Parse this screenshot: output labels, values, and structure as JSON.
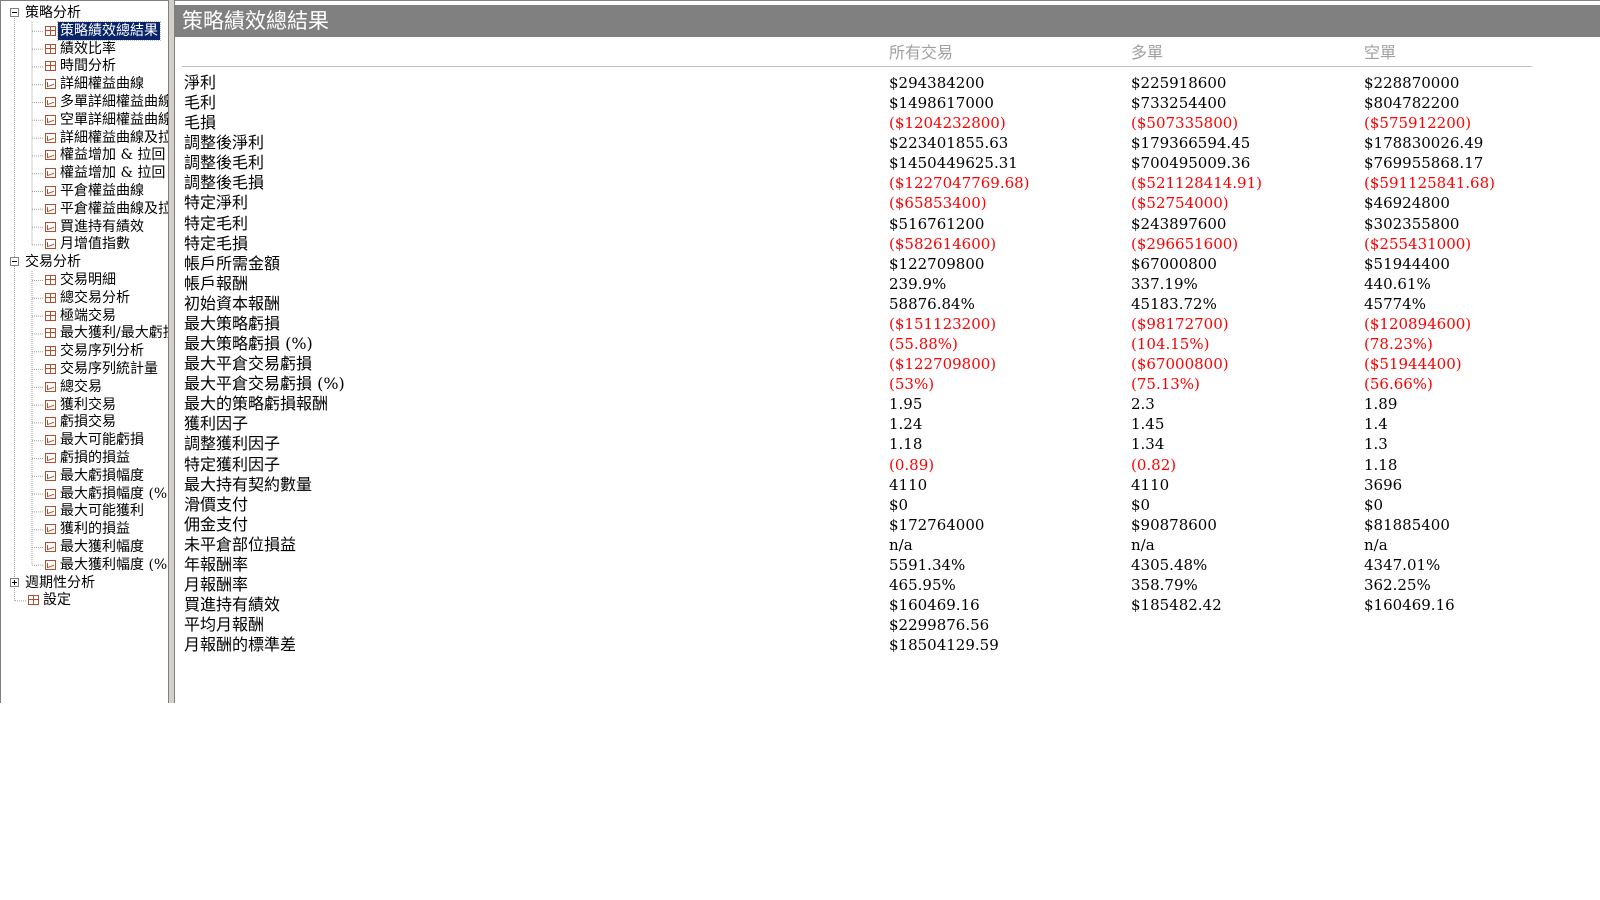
{
  "tree": {
    "nodes": [
      {
        "label": "策略分析",
        "type": "group",
        "expander": "minus",
        "level": 0
      },
      {
        "label": "策略績效總結果",
        "type": "table",
        "level": 1,
        "selected": true
      },
      {
        "label": "績效比率",
        "type": "table",
        "level": 1
      },
      {
        "label": "時間分析",
        "type": "table",
        "level": 1
      },
      {
        "label": "詳細權益曲線",
        "type": "chart",
        "level": 1
      },
      {
        "label": "多單詳細權益曲線",
        "type": "chart",
        "level": 1
      },
      {
        "label": "空單詳細權益曲線",
        "type": "chart",
        "level": 1
      },
      {
        "label": "詳細權益曲線及拉回",
        "type": "chart",
        "level": 1
      },
      {
        "label": "權益增加 & 拉回",
        "type": "chart",
        "level": 1
      },
      {
        "label": "權益增加 & 拉回",
        "type": "chart",
        "level": 1
      },
      {
        "label": "平倉權益曲線",
        "type": "chart",
        "level": 1
      },
      {
        "label": "平倉權益曲線及拉回",
        "type": "chart",
        "level": 1
      },
      {
        "label": "買進持有績效",
        "type": "chart",
        "level": 1
      },
      {
        "label": "月增值指數",
        "type": "chart",
        "level": 1
      },
      {
        "label": "交易分析",
        "type": "group",
        "expander": "minus",
        "level": 0
      },
      {
        "label": "交易明細",
        "type": "table",
        "level": 1
      },
      {
        "label": "總交易分析",
        "type": "table",
        "level": 1
      },
      {
        "label": "極端交易",
        "type": "table",
        "level": 1
      },
      {
        "label": "最大獲利/最大虧損",
        "type": "table",
        "level": 1
      },
      {
        "label": "交易序列分析",
        "type": "table",
        "level": 1
      },
      {
        "label": "交易序列統計量",
        "type": "table",
        "level": 1
      },
      {
        "label": "總交易",
        "type": "chart",
        "level": 1
      },
      {
        "label": "獲利交易",
        "type": "chart",
        "level": 1
      },
      {
        "label": "虧損交易",
        "type": "chart",
        "level": 1
      },
      {
        "label": "最大可能虧損",
        "type": "chart",
        "level": 1
      },
      {
        "label": "虧損的損益",
        "type": "chart",
        "level": 1
      },
      {
        "label": "最大虧損幅度",
        "type": "chart",
        "level": 1
      },
      {
        "label": "最大虧損幅度 (%)",
        "type": "chart",
        "level": 1
      },
      {
        "label": "最大可能獲利",
        "type": "chart",
        "level": 1
      },
      {
        "label": "獲利的損益",
        "type": "chart",
        "level": 1
      },
      {
        "label": "最大獲利幅度",
        "type": "chart",
        "level": 1
      },
      {
        "label": "最大獲利幅度 (%)",
        "type": "chart",
        "level": 1
      },
      {
        "label": "週期性分析",
        "type": "group",
        "expander": "plus",
        "level": 0
      },
      {
        "label": "設定",
        "type": "table",
        "level": 0.5
      }
    ]
  },
  "main": {
    "title": "策略績效總結果",
    "columns": [
      "所有交易",
      "多單",
      "空單"
    ],
    "rows": [
      {
        "label": "淨利",
        "values": [
          "$294384200",
          "$225918600",
          "$228870000"
        ]
      },
      {
        "label": "毛利",
        "values": [
          "$1498617000",
          "$733254400",
          "$804782200"
        ]
      },
      {
        "label": "毛損",
        "values": [
          "($1204232800)",
          "($507335800)",
          "($575912200)"
        ]
      },
      {
        "label": "調整後淨利",
        "values": [
          "$223401855.63",
          "$179366594.45",
          "$178830026.49"
        ]
      },
      {
        "label": "調整後毛利",
        "values": [
          "$1450449625.31",
          "$700495009.36",
          "$769955868.17"
        ]
      },
      {
        "label": "調整後毛損",
        "values": [
          "($1227047769.68)",
          "($521128414.91)",
          "($591125841.68)"
        ]
      },
      {
        "label": "特定淨利",
        "values": [
          "($65853400)",
          "($52754000)",
          "$46924800"
        ]
      },
      {
        "label": "特定毛利",
        "values": [
          "$516761200",
          "$243897600",
          "$302355800"
        ]
      },
      {
        "label": "特定毛損",
        "values": [
          "($582614600)",
          "($296651600)",
          "($255431000)"
        ]
      },
      {
        "label": "帳戶所需金額",
        "values": [
          "$122709800",
          "$67000800",
          "$51944400"
        ]
      },
      {
        "label": "帳戶報酬",
        "values": [
          "239.9%",
          "337.19%",
          "440.61%"
        ]
      },
      {
        "label": "初始資本報酬",
        "values": [
          "58876.84%",
          "45183.72%",
          "45774%"
        ]
      },
      {
        "label": "最大策略虧損",
        "values": [
          "($151123200)",
          "($98172700)",
          "($120894600)"
        ]
      },
      {
        "label": "最大策略虧損 (%)",
        "values": [
          "(55.88%)",
          "(104.15%)",
          "(78.23%)"
        ]
      },
      {
        "label": "最大平倉交易虧損",
        "values": [
          "($122709800)",
          "($67000800)",
          "($51944400)"
        ]
      },
      {
        "label": "最大平倉交易虧損 (%)",
        "values": [
          "(53%)",
          "(75.13%)",
          "(56.66%)"
        ]
      },
      {
        "label": "最大的策略虧損報酬",
        "values": [
          "1.95",
          "2.3",
          "1.89"
        ]
      },
      {
        "label": "獲利因子",
        "values": [
          "1.24",
          "1.45",
          "1.4"
        ]
      },
      {
        "label": "調整獲利因子",
        "values": [
          "1.18",
          "1.34",
          "1.3"
        ]
      },
      {
        "label": "特定獲利因子",
        "values": [
          "(0.89)",
          "(0.82)",
          "1.18"
        ]
      },
      {
        "label": "最大持有契約數量",
        "values": [
          "4110",
          "4110",
          "3696"
        ]
      },
      {
        "label": "滑價支付",
        "values": [
          "$0",
          "$0",
          "$0"
        ]
      },
      {
        "label": "佣金支付",
        "values": [
          "$172764000",
          "$90878600",
          "$81885400"
        ]
      },
      {
        "label": "未平倉部位損益",
        "values": [
          "n/a",
          "n/a",
          "n/a"
        ]
      },
      {
        "label": "年報酬率",
        "values": [
          "5591.34%",
          "4305.48%",
          "4347.01%"
        ]
      },
      {
        "label": "月報酬率",
        "values": [
          "465.95%",
          "358.79%",
          "362.25%"
        ]
      },
      {
        "label": "買進持有績效",
        "values": [
          "$160469.16",
          "$185482.42",
          "$160469.16"
        ]
      },
      {
        "label": "平均月報酬",
        "values": [
          "$2299876.56",
          "",
          ""
        ]
      },
      {
        "label": "月報酬的標準差",
        "values": [
          "$18504129.59",
          "",
          ""
        ]
      }
    ]
  },
  "colors": {
    "title_bar": "#808080",
    "negative": "#ff0000",
    "header_text": "#a0a0a0",
    "selection": "#0a246a"
  }
}
